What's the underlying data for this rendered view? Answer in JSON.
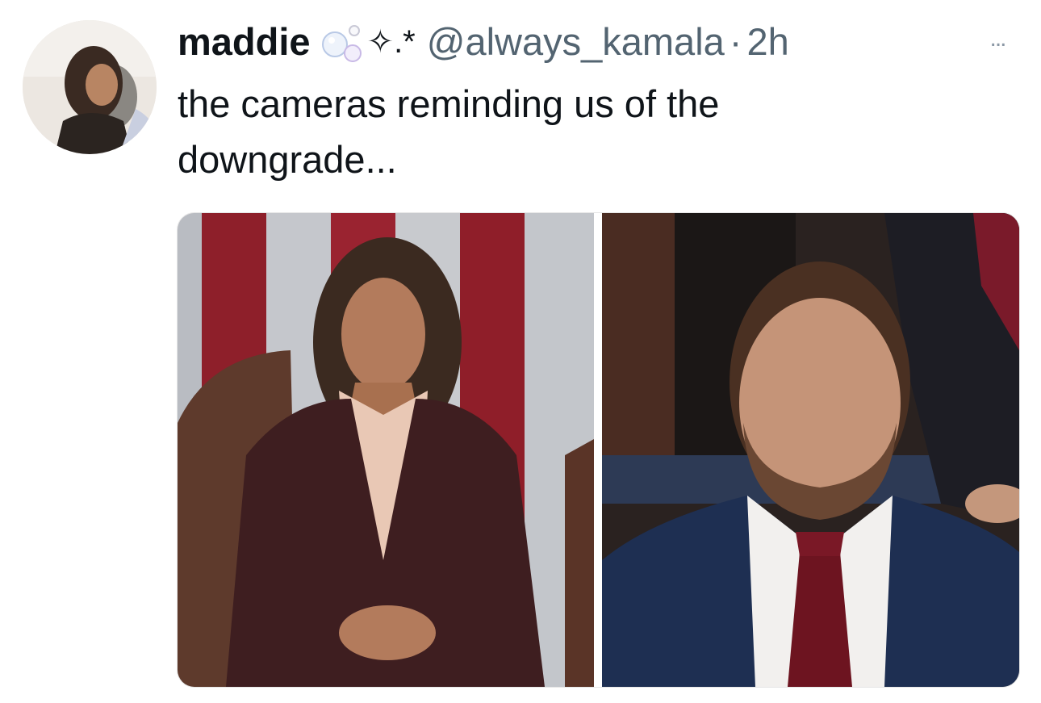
{
  "tweet": {
    "display_name": "maddie",
    "name_emoji": "🫧",
    "name_sparkle": "✧.*",
    "handle": "@always_kamala",
    "separator": "·",
    "time": "2h",
    "more_icon": "...",
    "text": "the cameras reminding us of the downgrade..."
  },
  "icons": {
    "more": "more-options-icon",
    "bubbles": "bubbles-emoji-icon"
  },
  "colors": {
    "text_primary": "#0f1419",
    "text_secondary": "#536471",
    "background": "#ffffff"
  }
}
